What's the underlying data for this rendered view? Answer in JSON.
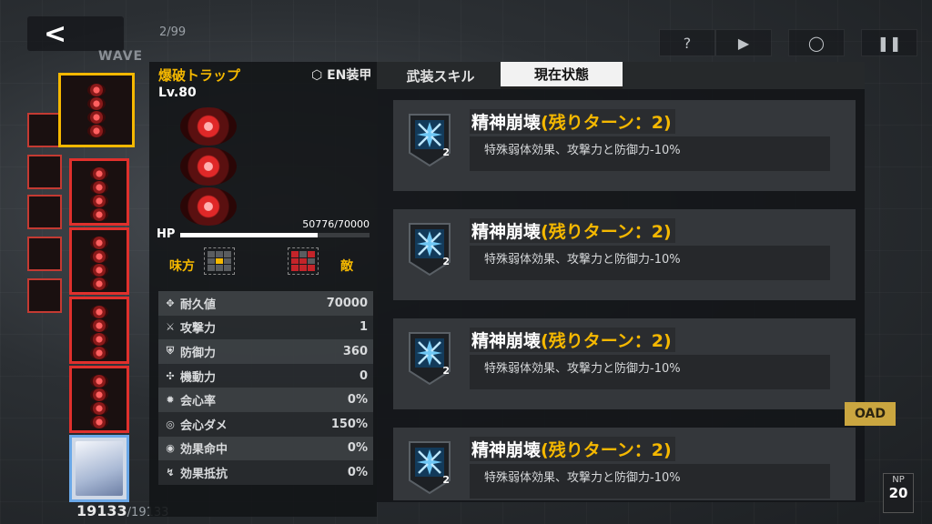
{
  "hud": {
    "back_icon": "back-chevron-icon",
    "wave_label": "WAVE",
    "wave_count": "2/99",
    "buttons": [
      "help-icon",
      "play-icon",
      "target-icon",
      "pause-icon"
    ],
    "load_label": "OAD",
    "np_label": "NP",
    "np_value": "20"
  },
  "roster": {
    "ally_hp": "19133",
    "ally_hp_max": "/19133"
  },
  "unit": {
    "name": "爆破トラップ",
    "level": "Lv.80",
    "en_tag": "EN装甲",
    "hp_label": "HP",
    "hp_value": "50776/70000",
    "hp_fraction": 0.7254,
    "ally_label": "味方",
    "enemy_label": "敵",
    "stats": [
      {
        "icon": "durability-icon",
        "label": "耐久値",
        "value": "70000"
      },
      {
        "icon": "attack-icon",
        "label": "攻撃力",
        "value": "1"
      },
      {
        "icon": "defense-icon",
        "label": "防御力",
        "value": "360"
      },
      {
        "icon": "mobility-icon",
        "label": "機動力",
        "value": "0"
      },
      {
        "icon": "crit-rate-icon",
        "label": "会心率",
        "value": "0%"
      },
      {
        "icon": "crit-damage-icon",
        "label": "会心ダメ",
        "value": "150%"
      },
      {
        "icon": "effect-hit-icon",
        "label": "効果命中",
        "value": "0%"
      },
      {
        "icon": "effect-resist-icon",
        "label": "効果抵抗",
        "value": "0%"
      }
    ]
  },
  "tabs": [
    {
      "label": "武装スキル",
      "active": false
    },
    {
      "label": "現在状態",
      "active": true
    }
  ],
  "effects": [
    {
      "title": "精神崩壊",
      "turns": "(残りターン：2)",
      "desc": "特殊弱体効果、攻撃力と防御力-10%",
      "stack": "2"
    },
    {
      "title": "精神崩壊",
      "turns": "(残りターン：2)",
      "desc": "特殊弱体効果、攻撃力と防御力-10%",
      "stack": "2"
    },
    {
      "title": "精神崩壊",
      "turns": "(残りターン：2)",
      "desc": "特殊弱体効果、攻撃力と防御力-10%",
      "stack": "2"
    },
    {
      "title": "精神崩壊",
      "turns": "(残りターン：2)",
      "desc": "特殊弱体効果、攻撃力と防御力-10%",
      "stack": "2"
    }
  ],
  "colors": {
    "accent": "#f5b800",
    "enemy_border": "#e0302c",
    "ally_border": "#6aa8e8",
    "debuff_icon": "#3aa6e0"
  }
}
